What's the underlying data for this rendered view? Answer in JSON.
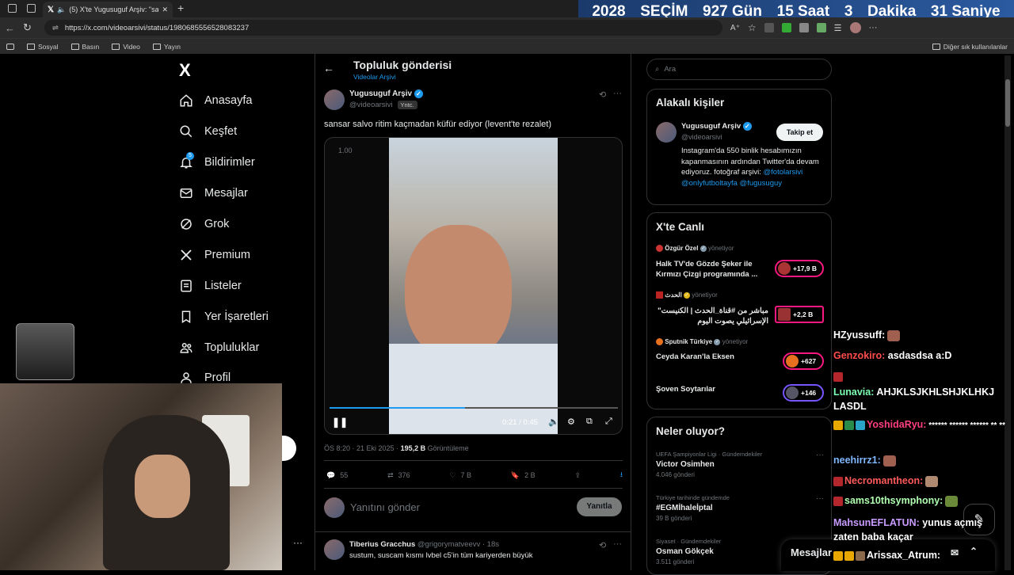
{
  "browser": {
    "tab_title": "(5) X'te Yugusuguf Arşiv: \"sa",
    "url": "https://x.com/videoarsivi/status/1980685556528083237",
    "bookmarks": [
      "Sosyal",
      "Basın",
      "Video",
      "Yayın"
    ],
    "bookmarks_other": "Diğer sık kullanılanlar"
  },
  "countdown": {
    "year": "2028",
    "label": "SEÇİM",
    "days": "927 Gün",
    "hours": "15 Saat",
    "minutes": "3",
    "minutes_unit": "Dakika",
    "seconds": "31 Saniye"
  },
  "nav": {
    "logo": "X",
    "items": [
      "Anasayfa",
      "Keşfet",
      "Bildirimler",
      "Mesajlar",
      "Grok",
      "Premium",
      "Listeler",
      "Yer İşaretleri",
      "Topluluklar",
      "Profil"
    ],
    "notif_count": "5",
    "more": "···"
  },
  "header": {
    "title": "Topluluk gönderisi",
    "subtitle": "Videolar Arşivi"
  },
  "post": {
    "name": "Yugusuguf Arşiv",
    "handle": "@videoarsivi",
    "tag": "Yntc.",
    "text": "sansar salvo ritim kaçmadan küfür ediyor (levent'te rezalet)",
    "speed": "1.00",
    "time": "0:21 / 0:45",
    "progress": 0.47,
    "meta_time": "ÖS 8:20 · 21 Eki 2025 · ",
    "views": "195,2 B",
    "views_label": " Görüntüleme",
    "replies": "55",
    "reposts": "376",
    "likes": "7 B",
    "bookmarks": "2 B"
  },
  "reply": {
    "placeholder": "Yanıtını gönder",
    "button": "Yanıtla"
  },
  "comment": {
    "name": "Tiberius Gracchus",
    "handle": "@grigorymatveevv · 18s",
    "text": "sustum, suscam kısmı lvbel c5'in tüm kariyerden büyük"
  },
  "search": {
    "placeholder": "Ara"
  },
  "related": {
    "title": "Alakalı kişiler",
    "name": "Yugusuguf Arşiv",
    "handle": "@videoarsivi",
    "follow": "Takip et",
    "bio": "Instagram'da 550 binlik hesabımızın kapanmasının ardından Twitter'da devam ediyoruz. fotoğraf arşivi: ",
    "bio_links": "@fotolarsivi @onlyfutboltayfa @fugusuguy"
  },
  "live": {
    "title": "X'te Canlı",
    "items": [
      {
        "host": "Özgür Özel",
        "status": "yönetiyor",
        "title": "Halk TV'de Gözde Şeker ile Kırmızı Çizgi programında ...",
        "count": "+17,9 B"
      },
      {
        "host": "الحدث",
        "status": "yönetiyor",
        "title": "مباشر من #قناة_الحدث | الكنيست\" الإسرائيلي يصوت اليوم",
        "count": "+2,2 B"
      },
      {
        "host": "Sputnik Türkiye",
        "status": "yönetiyor",
        "title": "Ceyda Karan'la Eksen",
        "count": "+627"
      },
      {
        "host": "",
        "status": "",
        "title": "Şoven Soytarılar",
        "count": "+146"
      }
    ]
  },
  "trends": {
    "title": "Neler oluyor?",
    "items": [
      {
        "cat": "UEFA Şampiyonlar Ligi · Gündemdekiler",
        "name": "Victor Osimhen",
        "count": "4.046 gönderi"
      },
      {
        "cat": "Türkiye tarihinde gündemde",
        "name": "#EGMİhaleİptal",
        "count": "39 B gönderi"
      },
      {
        "cat": "Siyaset · Gündemdekiler",
        "name": "Osman Gökçek",
        "count": "3.511 gönderi"
      }
    ]
  },
  "messages": {
    "label": "Mesajlar"
  },
  "chat": [
    {
      "user": "HZyussuff:",
      "msg": "",
      "color": "#ffffff"
    },
    {
      "user": "Genzokiro:",
      "msg": "asdasdsa a:D",
      "color": "#ff4d4d"
    },
    {
      "user": "Lunavia:",
      "msg": "AHJKLSJKHLSHJKLHKJ LASDL",
      "color": "#7cffb0"
    },
    {
      "user": "YoshidaRyu:",
      "msg": "****** ****** ****** ** **",
      "color": "#ff3f7f"
    },
    {
      "user": "neehirrz1:",
      "msg": "",
      "color": "#7fb8ff"
    },
    {
      "user": "Necromantheon:",
      "msg": "",
      "color": "#ff5a5a"
    },
    {
      "user": "sams10thsymphony:",
      "msg": "",
      "color": "#b0ffb0"
    },
    {
      "user": "MahsunEFLATUN:",
      "msg": "yunus açmış zaten baba kaçar",
      "color": "#c89cff"
    },
    {
      "user": "Arissax_Atrum:",
      "msg": "",
      "color": "#ffffff"
    }
  ],
  "colors": {
    "accent": "#1d9bf0",
    "live": "#f91880",
    "chrome": "#2b2b2b",
    "countdown": "#2b5aa0"
  }
}
